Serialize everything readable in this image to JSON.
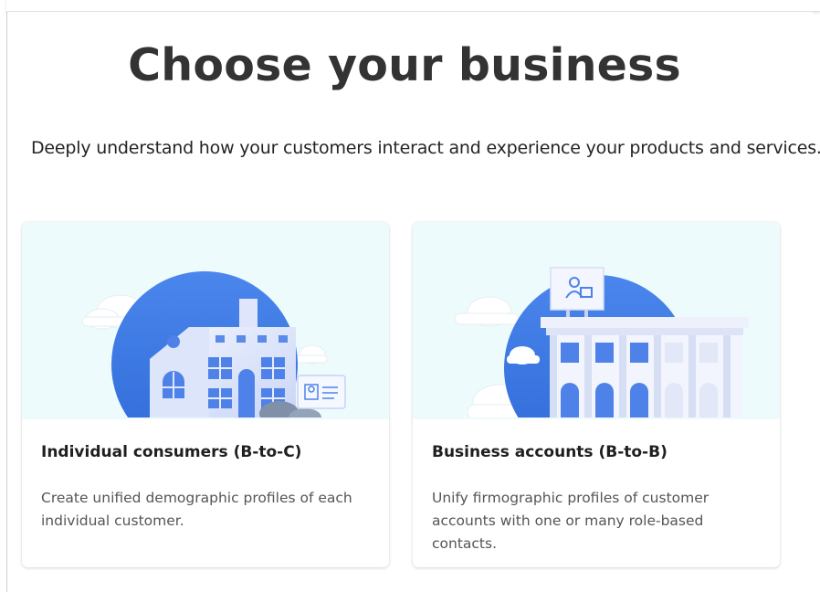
{
  "page": {
    "title": "Choose your business",
    "subtitle": "Deeply understand how your customers interact and experience your products and services."
  },
  "cards": [
    {
      "title": "Individual consumers (B-to-C)",
      "description": "Create unified demographic profiles of each individual customer.",
      "illustration_icon": "house-illustration-icon"
    },
    {
      "title": "Business accounts (B-to-B)",
      "description": "Unify firmographic profiles of customer accounts with one or many role-based contacts.",
      "illustration_icon": "office-building-illustration-icon"
    }
  ],
  "colors": {
    "illustration_bg": "#eefbfd",
    "sun_blue": "#3f7ce5",
    "building_light": "#e8ecfb",
    "window_blue": "#4f82e8"
  }
}
